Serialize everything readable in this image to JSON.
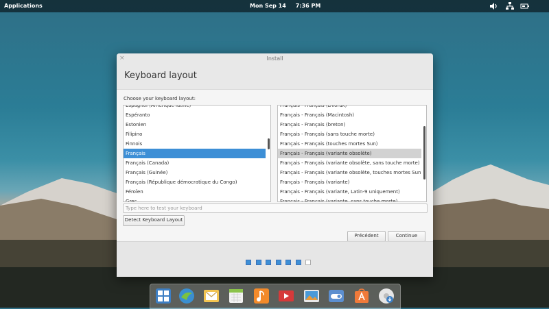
{
  "top_panel": {
    "applications_label": "Applications",
    "date": "Mon Sep 14",
    "time": "7:36 PM",
    "icons": [
      "volume-icon",
      "network-icon",
      "battery-icon"
    ]
  },
  "window": {
    "title": "Install",
    "close_glyph": "×",
    "heading": "Keyboard layout",
    "choose_label": "Choose your keyboard layout:",
    "languages": [
      "Espagnol (Amérique latine)",
      "Espéranto",
      "Estonien",
      "Filipino",
      "Finnois",
      "Français",
      "Français (Canada)",
      "Français (Guinée)",
      "Français (République démocratique du Congo)",
      "Féroïen",
      "Grec"
    ],
    "selected_language": "Français",
    "variants": [
      "Français - Français (Dvorak)",
      "Français - Français (Macintosh)",
      "Français - Français (breton)",
      "Français - Français (sans touche morte)",
      "Français - Français (touches mortes Sun)",
      "Français - Français (variante obsolète)",
      "Français - Français (variante obsolète, sans touche morte)",
      "Français - Français (variante obsolète, touches mortes Sun)",
      "Français - Français (variante)",
      "Français - Français (variante, Latin-9 uniquement)",
      "Français - Français (variante, sans touche morte)"
    ],
    "selected_variant": "Français - Français (variante obsolète)",
    "test_placeholder": "Type here to test your keyboard",
    "detect_button": "Detect Keyboard Layout",
    "previous_button": "Précédent",
    "continue_button": "Continue",
    "progress": {
      "total_steps": 7,
      "completed_steps": 6
    }
  },
  "dock": {
    "items": [
      "multitasking-view-icon",
      "web-browser-icon",
      "mail-icon",
      "calendar-icon",
      "music-icon",
      "videos-icon",
      "photos-icon",
      "system-settings-icon",
      "appcenter-icon",
      "installer-icon"
    ]
  },
  "colors": {
    "selection_blue": "#3d8fd6",
    "selection_grey": "#d2d2d2",
    "panel_bg": "#000000"
  }
}
